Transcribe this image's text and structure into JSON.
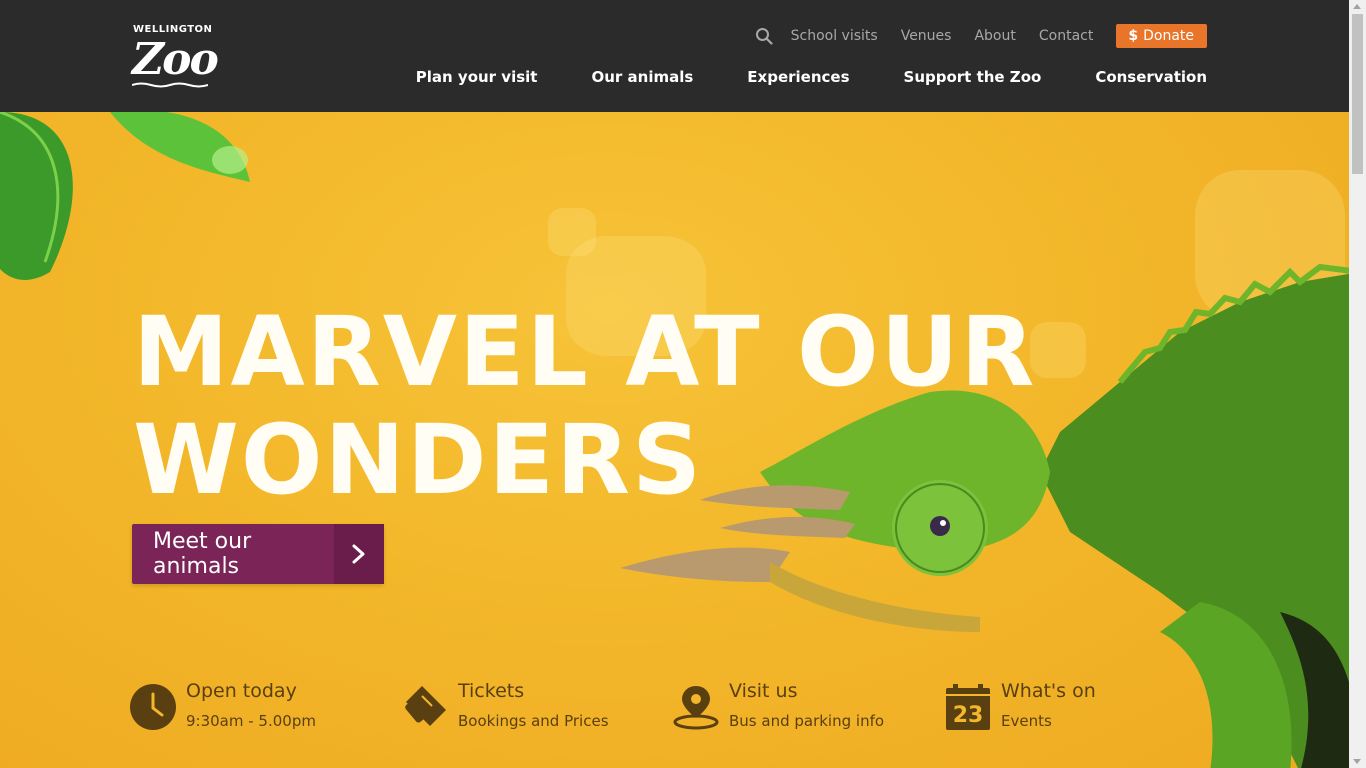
{
  "logo": {
    "small": "WELLINGTON",
    "big": "Zoo"
  },
  "util_nav": {
    "search_icon": "search-icon",
    "links": [
      "School visits",
      "Venues",
      "About",
      "Contact"
    ],
    "donate_symbol": "$",
    "donate_label": "Donate"
  },
  "main_nav": [
    "Plan your visit",
    "Our animals",
    "Experiences",
    "Support the Zoo",
    "Conservation"
  ],
  "hero": {
    "line1": "MARVEL AT OUR",
    "line2": "WONDERS",
    "cta_label": "Meet our animals",
    "cta_icon": "chevron-right-icon"
  },
  "info": [
    {
      "icon": "clock-icon",
      "title": "Open today",
      "sub": "9:30am - 5.00pm"
    },
    {
      "icon": "ticket-icon",
      "title": "Tickets",
      "sub": "Bookings and Prices"
    },
    {
      "icon": "map-pin-icon",
      "title": "Visit us",
      "sub": "Bus and parking info"
    },
    {
      "icon": "calendar-icon",
      "title": "What's on",
      "sub": "Events",
      "day": "23"
    }
  ],
  "colors": {
    "header_bg": "#2b2b2b",
    "hero_bg": "#f3b72a",
    "donate": "#e8752a",
    "cta": "#7b2458",
    "info_text": "#5a3f10"
  }
}
